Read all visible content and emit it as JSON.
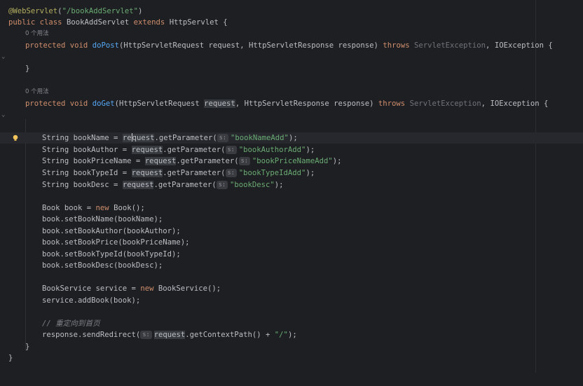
{
  "editor": {
    "lines": {
      "annotation": {
        "at": "@WebServlet",
        "paren_open": "(",
        "path": "\"/bookAddServlet\"",
        "paren_close": ")"
      },
      "class_decl": {
        "kw1": "public",
        "kw2": "class",
        "name": "BookAddServlet",
        "kw3": "extends",
        "super": "HttpServlet",
        "brace": "{"
      },
      "usage_hint_1": "0 个用法",
      "dopost": {
        "kw1": "protected",
        "kw2": "void",
        "name": "doPost",
        "params": "(HttpServletRequest request, HttpServletResponse response)",
        "throws": "throws",
        "ex1": "ServletException",
        "comma": ",",
        "ex2": "IOException",
        "brace": "{"
      },
      "close_dopost": "}",
      "usage_hint_2": "0 个用法",
      "doget": {
        "kw1": "protected",
        "kw2": "void",
        "name": "doGet",
        "p1": "(HttpServletRequest ",
        "p_req": "request",
        "p2": ", HttpServletResponse response)",
        "throws": "throws",
        "ex1": "ServletException",
        "comma": ",",
        "ex2": "IOException",
        "brace": "{"
      },
      "param_lines": [
        {
          "decl": "String bookName = ",
          "req": "request",
          "call": ".getParameter(",
          "hint": "s:",
          "str": "\"bookNameAdd\"",
          "end": ");"
        },
        {
          "decl": "String bookAuthor = ",
          "req": "request",
          "call": ".getParameter(",
          "hint": "s:",
          "str": "\"bookAuthorAdd\"",
          "end": ");"
        },
        {
          "decl": "String bookPriceName = ",
          "req": "request",
          "call": ".getParameter(",
          "hint": "s:",
          "str": "\"bookPriceNameAdd\"",
          "end": ");"
        },
        {
          "decl": "String bookTypeId = ",
          "req": "request",
          "call": ".getParameter(",
          "hint": "s:",
          "str": "\"bookTypeIdAdd\"",
          "end": ");"
        },
        {
          "decl": "String bookDesc = ",
          "req": "request",
          "call": ".getParameter(",
          "hint": "s:",
          "str": "\"bookDesc\"",
          "end": ");"
        }
      ],
      "book_new": {
        "a": "Book book = ",
        "kw": "new",
        "b": " Book();"
      },
      "setters": [
        "book.setBookName(bookName);",
        "book.setBookAuthor(bookAuthor);",
        "book.setBookPrice(bookPriceName);",
        "book.setBookTypeId(bookTypeId);",
        "book.setBookDesc(bookDesc);"
      ],
      "service_new": {
        "a": "BookService service = ",
        "kw": "new",
        "b": " BookService();"
      },
      "service_call": "service.addBook(book);",
      "comment": "// 重定向到首页",
      "redirect": {
        "a": "response.sendRedirect(",
        "hint": "s:",
        "req": "request",
        "b": ".getContextPath() + ",
        "str": "\"/\"",
        "end": ");"
      },
      "close_doget": "}",
      "close_class": "}"
    },
    "colors": {
      "background": "#1e1f22",
      "keyword": "#cf8e6d",
      "method": "#56a8f5",
      "string": "#6aab73",
      "annotation": "#b3ae60"
    },
    "icons": {
      "fold": "chevron-down-icon",
      "intention": "lightbulb-icon"
    }
  }
}
